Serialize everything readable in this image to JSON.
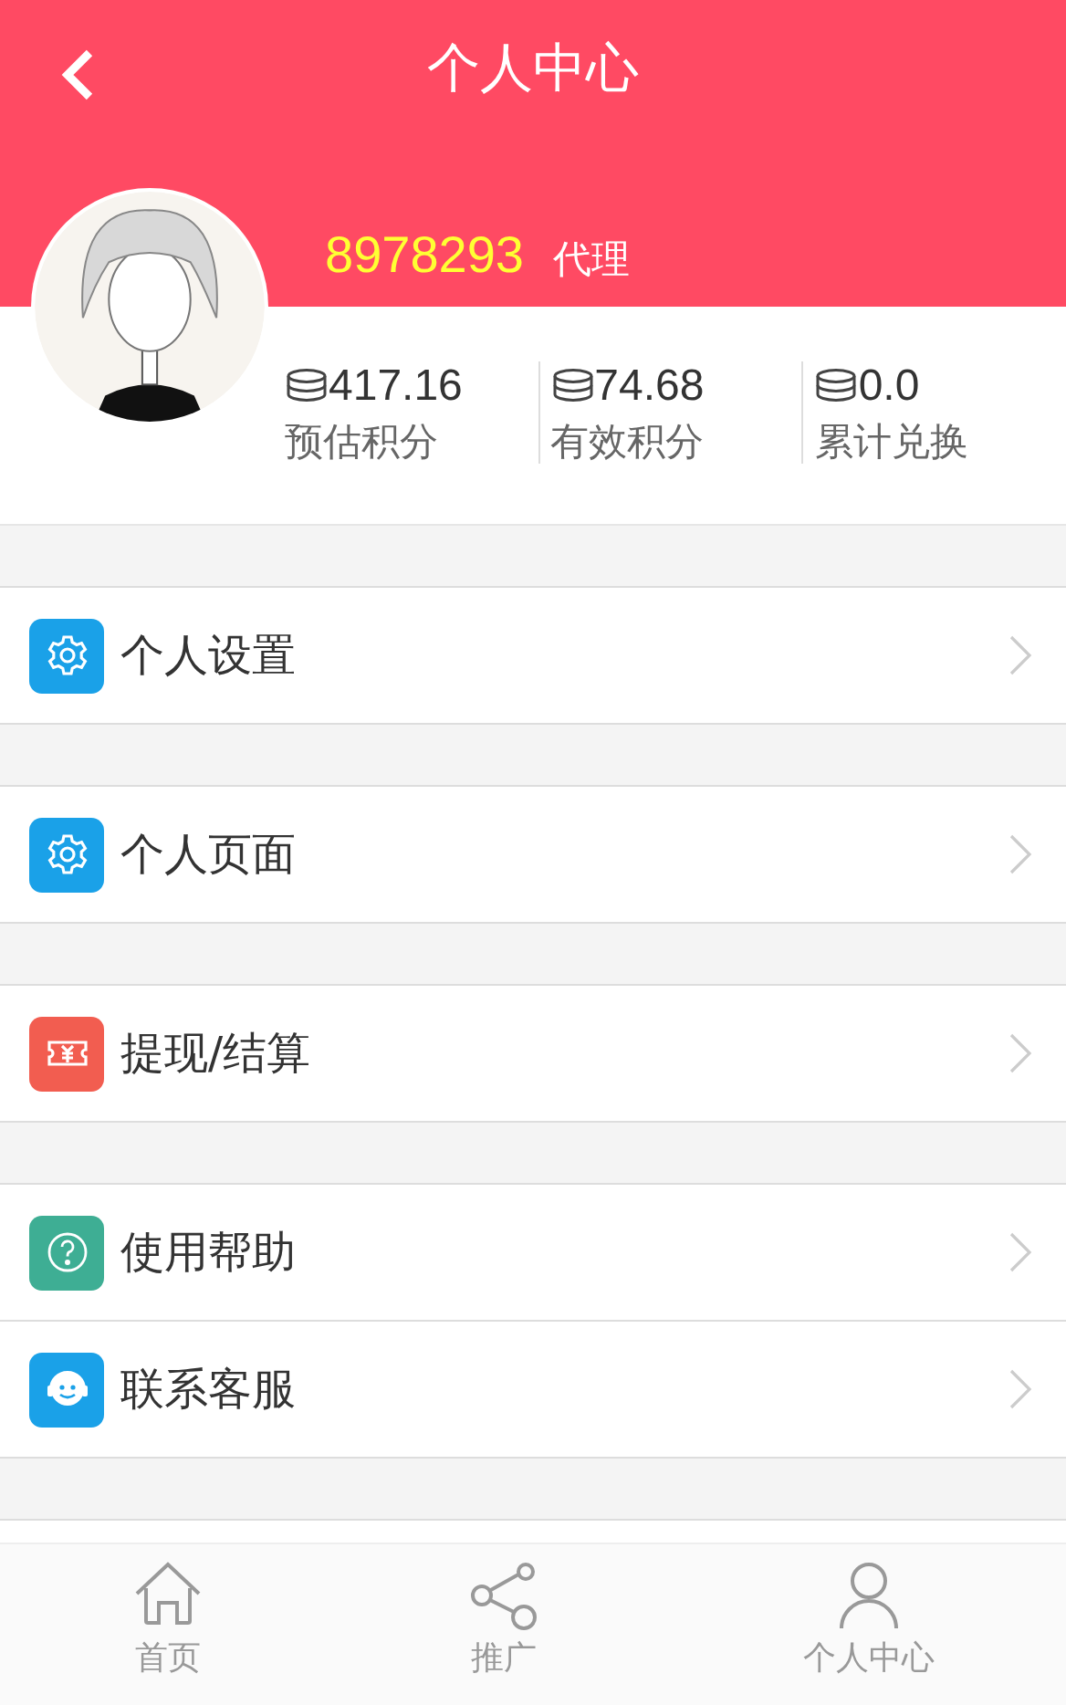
{
  "header": {
    "title": "个人中心"
  },
  "profile": {
    "id": "8978293",
    "role": "代理",
    "stats": [
      {
        "value": "417.16",
        "label": "预估积分"
      },
      {
        "value": "74.68",
        "label": "有效积分"
      },
      {
        "value": "0.0",
        "label": "累计兑换"
      }
    ]
  },
  "menu_groups": [
    [
      {
        "label": "个人设置",
        "kind": "gear",
        "color": "#1aa1e8"
      }
    ],
    [
      {
        "label": "个人页面",
        "kind": "gear",
        "color": "#1aa1e8"
      }
    ],
    [
      {
        "label": "提现/结算",
        "kind": "ticket",
        "color": "#f25d50"
      }
    ],
    [
      {
        "label": "使用帮助",
        "kind": "help",
        "color": "#3eae94"
      },
      {
        "label": "联系客服",
        "kind": "headset",
        "color": "#1aa1e8"
      }
    ]
  ],
  "tab_bar": [
    {
      "label": "首页",
      "kind": "home"
    },
    {
      "label": "推广",
      "kind": "share"
    },
    {
      "label": "个人中心",
      "kind": "person"
    }
  ]
}
